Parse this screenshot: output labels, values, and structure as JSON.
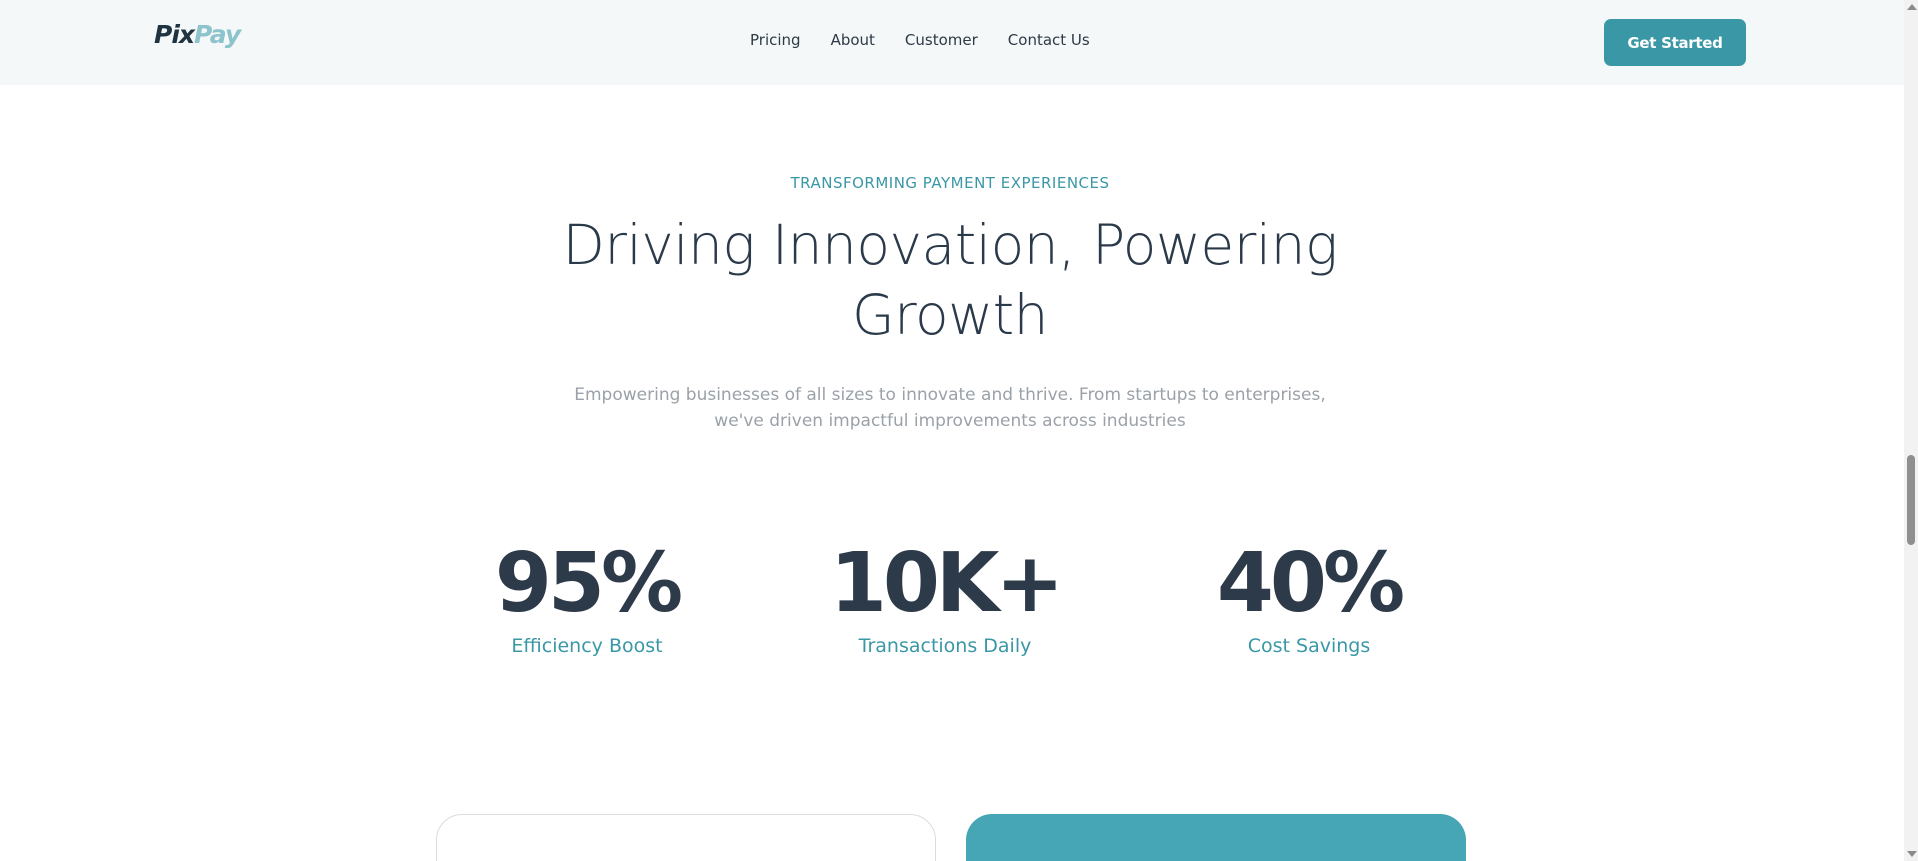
{
  "header": {
    "logo": {
      "part1": "Pix",
      "part2": "Pay"
    },
    "nav": [
      {
        "label": "Pricing"
      },
      {
        "label": "About"
      },
      {
        "label": "Customer"
      },
      {
        "label": "Contact Us"
      }
    ],
    "cta_label": "Get Started"
  },
  "hero": {
    "eyebrow": "TRANSFORMING PAYMENT EXPERIENCES",
    "headline_line1": "Driving Innovation, Powering",
    "headline_line2": "Growth",
    "subtext_line1": "Empowering businesses of all sizes to innovate and thrive. From startups to enterprises,",
    "subtext_line2": "we've driven impactful improvements across industries"
  },
  "stats": [
    {
      "value": "95%",
      "label": "Efficiency Boost"
    },
    {
      "value": "10K+",
      "label": "Transactions Daily"
    },
    {
      "value": "40%",
      "label": "Cost Savings"
    }
  ],
  "colors": {
    "accent": "#3a97a6",
    "dark_text": "#2d3a4a",
    "header_bg": "#f4f8f8",
    "card_teal": "#46a6b5"
  }
}
